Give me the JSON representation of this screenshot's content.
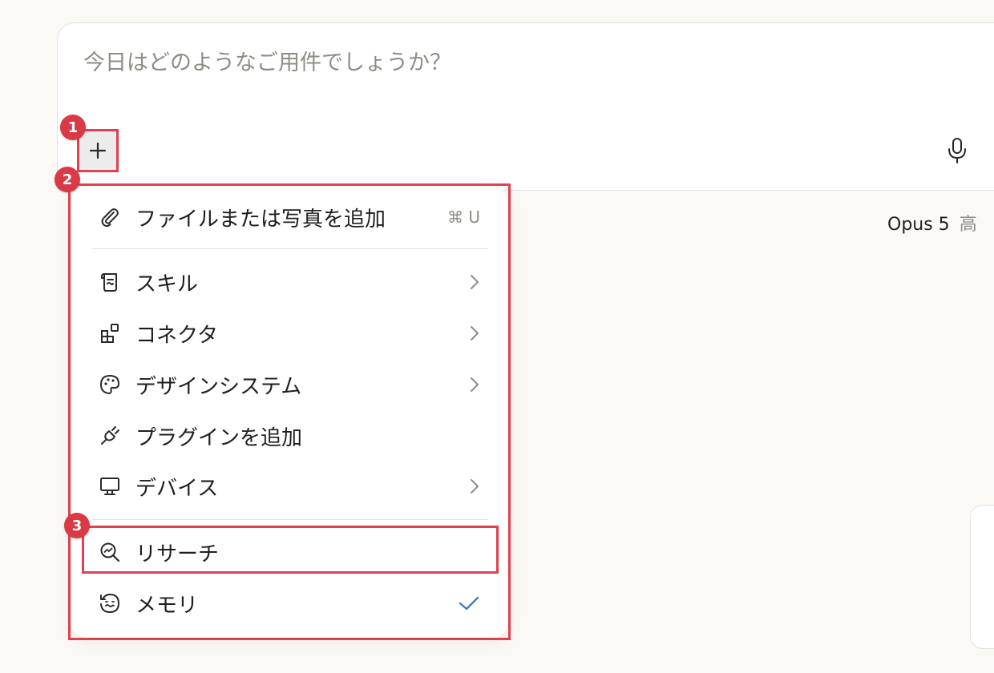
{
  "composer": {
    "placeholder": "今日はどのようなご用件でしょうか？"
  },
  "model": {
    "name": "Opus 5",
    "effort": "高"
  },
  "menu": {
    "add_file": {
      "label": "ファイルまたは写真を追加",
      "shortcut": "⌘ U",
      "icon": "paperclip-icon"
    },
    "skills": {
      "label": "スキル",
      "icon": "scroll-icon"
    },
    "connectors": {
      "label": "コネクタ",
      "icon": "blocks-icon"
    },
    "design_system": {
      "label": "デザインシステム",
      "icon": "palette-icon"
    },
    "add_plugin": {
      "label": "プラグインを追加",
      "icon": "plug-icon"
    },
    "devices": {
      "label": "デバイス",
      "icon": "monitor-icon"
    },
    "research": {
      "label": "リサーチ",
      "icon": "search-chart-icon"
    },
    "memory": {
      "label": "メモリ",
      "icon": "memory-icon",
      "checked": true
    }
  },
  "annotations": {
    "badge_1": "1",
    "badge_2": "2",
    "badge_3": "3"
  },
  "colors": {
    "annotation": "#e0404f",
    "check": "#3b7dd8",
    "background": "#faf9f5"
  }
}
